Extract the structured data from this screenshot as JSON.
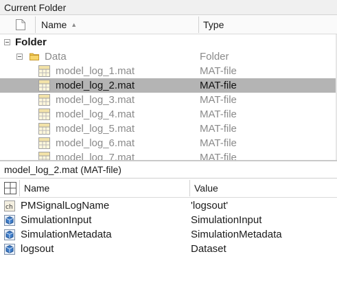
{
  "panel": {
    "title": "Current Folder"
  },
  "columns": {
    "name": "Name",
    "sort_indicator": "▲",
    "type": "Type"
  },
  "tree": {
    "root": {
      "label": "Folder"
    },
    "folder": {
      "name": "Data",
      "type": "Folder"
    },
    "files": [
      {
        "name": "model_log_1.mat",
        "type": "MAT-file",
        "selected": false
      },
      {
        "name": "model_log_2.mat",
        "type": "MAT-file",
        "selected": true
      },
      {
        "name": "model_log_3.mat",
        "type": "MAT-file",
        "selected": false
      },
      {
        "name": "model_log_4.mat",
        "type": "MAT-file",
        "selected": false
      },
      {
        "name": "model_log_5.mat",
        "type": "MAT-file",
        "selected": false
      },
      {
        "name": "model_log_6.mat",
        "type": "MAT-file",
        "selected": false
      },
      {
        "name": "model_log_7.mat",
        "type": "MAT-file",
        "selected": false
      }
    ]
  },
  "details": {
    "title": "model_log_2.mat  (MAT-file)",
    "columns": {
      "name": "Name",
      "value": "Value"
    },
    "variables": [
      {
        "name": "PMSignalLogName",
        "value": "'logsout'",
        "icon": "char-variable-icon"
      },
      {
        "name": "SimulationInput",
        "value": "SimulationInput",
        "icon": "object-variable-icon"
      },
      {
        "name": "SimulationMetadata",
        "value": "SimulationMetadata",
        "icon": "object-variable-icon"
      },
      {
        "name": "logsout",
        "value": "Dataset",
        "icon": "object-variable-icon"
      }
    ]
  },
  "colors": {
    "selection": "#b4b4b4",
    "muted_text": "#8a8a8a",
    "folder_yellow": "#f2c94c",
    "object_blue": "#3d7cc9"
  }
}
